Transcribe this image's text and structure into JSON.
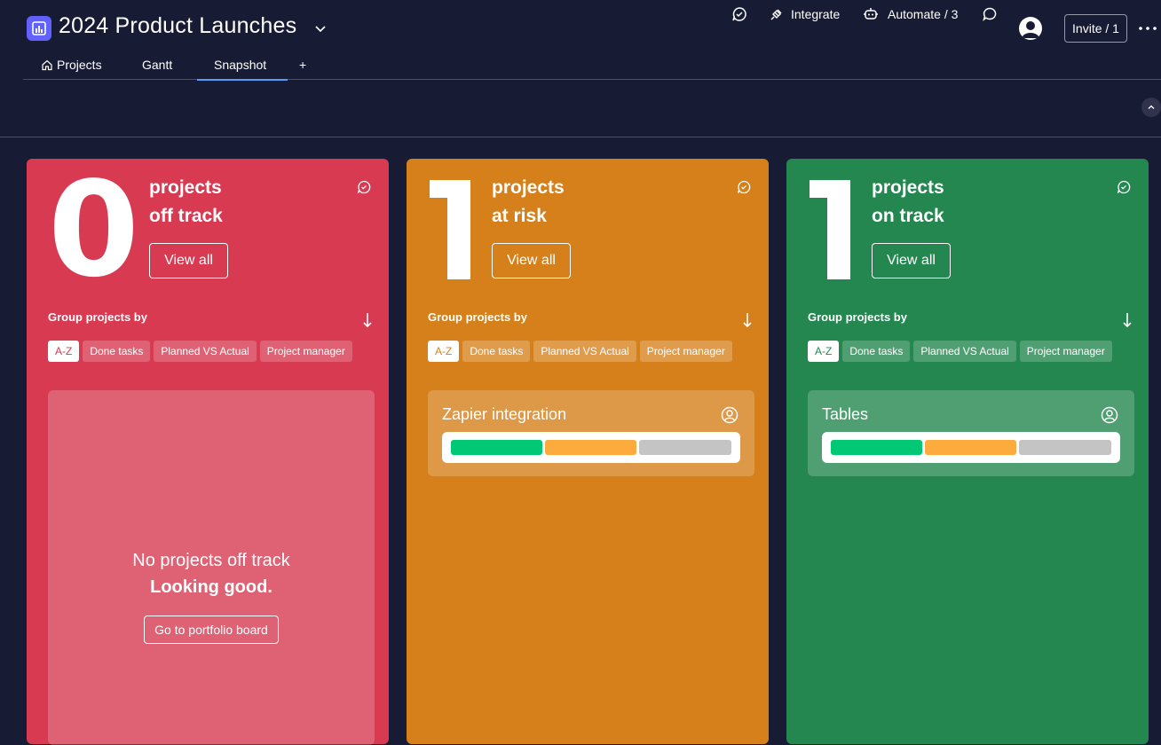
{
  "board": {
    "title": "2024 Product Launches",
    "logo_icon": "board-chart-icon",
    "accent": "#6161ff"
  },
  "toolbar": {
    "activity_icon": "activity-icon",
    "integrate_label": "Integrate",
    "automate_label": "Automate / 3",
    "updates_icon": "chat-bubble-icon",
    "invite_label": "Invite / 1"
  },
  "tabs": [
    {
      "label": "Projects",
      "icon": "home-icon",
      "active": false
    },
    {
      "label": "Gantt",
      "active": false
    },
    {
      "label": "Snapshot",
      "active": true
    },
    {
      "label": "+",
      "active": false
    }
  ],
  "cards": [
    {
      "count": "0",
      "line1": "projects",
      "line2": "off track",
      "view_all": "View all",
      "group_label": "Group projects by",
      "chips": [
        "A-Z",
        "Done tasks",
        "Planned VS Actual",
        "Project manager"
      ],
      "color": "#d83a52",
      "empty_line1": "No projects off track",
      "empty_line2": "Looking good.",
      "empty_button": "Go to portfolio board"
    },
    {
      "count": "1",
      "line1": "projects",
      "line2": "at risk",
      "view_all": "View all",
      "group_label": "Group projects by",
      "chips": [
        "A-Z",
        "Done tasks",
        "Planned VS Actual",
        "Project manager"
      ],
      "color": "#d5801a",
      "project": {
        "name": "Zapier integration",
        "segments": [
          {
            "color": "#00c875",
            "fraction": 0.333
          },
          {
            "color": "#fdab3d",
            "fraction": 0.333
          },
          {
            "color": "#c4c4c4",
            "fraction": 0.333
          }
        ]
      }
    },
    {
      "count": "1",
      "line1": "projects",
      "line2": "on track",
      "view_all": "View all",
      "group_label": "Group projects by",
      "chips": [
        "A-Z",
        "Done tasks",
        "Planned VS Actual",
        "Project manager"
      ],
      "color": "#258750",
      "project": {
        "name": "Tables",
        "segments": [
          {
            "color": "#00c875",
            "fraction": 0.333
          },
          {
            "color": "#fdab3d",
            "fraction": 0.333
          },
          {
            "color": "#c4c4c4",
            "fraction": 0.333
          }
        ]
      }
    }
  ]
}
